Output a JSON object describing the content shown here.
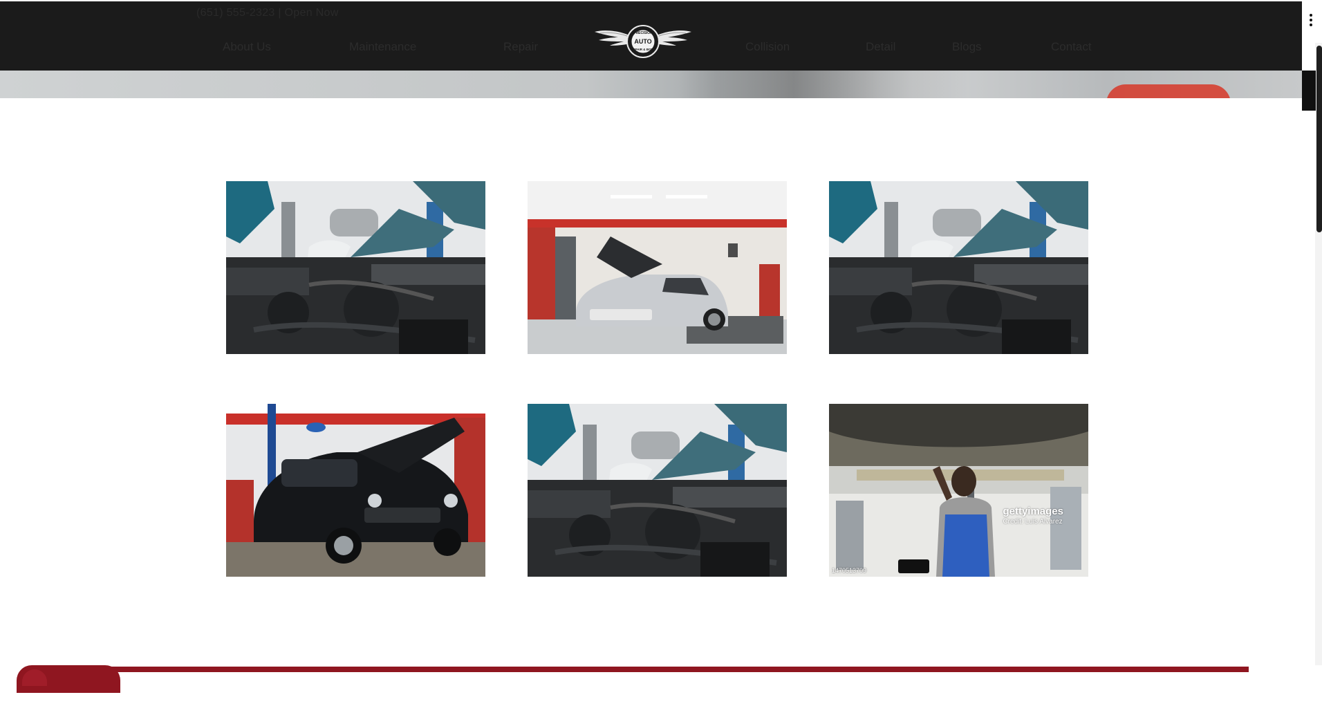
{
  "header": {
    "phone": "(651) 555-2323 | Open Now",
    "nav_left": [
      "About Us",
      "Maintenance",
      "Repair"
    ],
    "nav_right": [
      "Collision",
      "Detail",
      "Blogs",
      "Contact"
    ],
    "logo": {
      "line1": "PRECISION",
      "line2": "AUTO",
      "line3": "REPAIR & BODY"
    }
  },
  "gallery": {
    "photos": [
      {
        "subject": "gloved-hand-engine-bay"
      },
      {
        "subject": "silver-sports-car-garage"
      },
      {
        "subject": "gloved-hand-engine-bay"
      },
      {
        "subject": "black-sedan-hood-open"
      },
      {
        "subject": "gloved-hand-engine-bay"
      },
      {
        "subject": "mechanic-under-lift"
      }
    ],
    "watermark_brand": "gettyimages",
    "watermark_credit": "Credit: Luis Alvarez",
    "stock_id": "1470513709"
  },
  "colors": {
    "navbar": "#1b1b1b",
    "accent_red": "#8f1620",
    "background": "#ffffff"
  }
}
